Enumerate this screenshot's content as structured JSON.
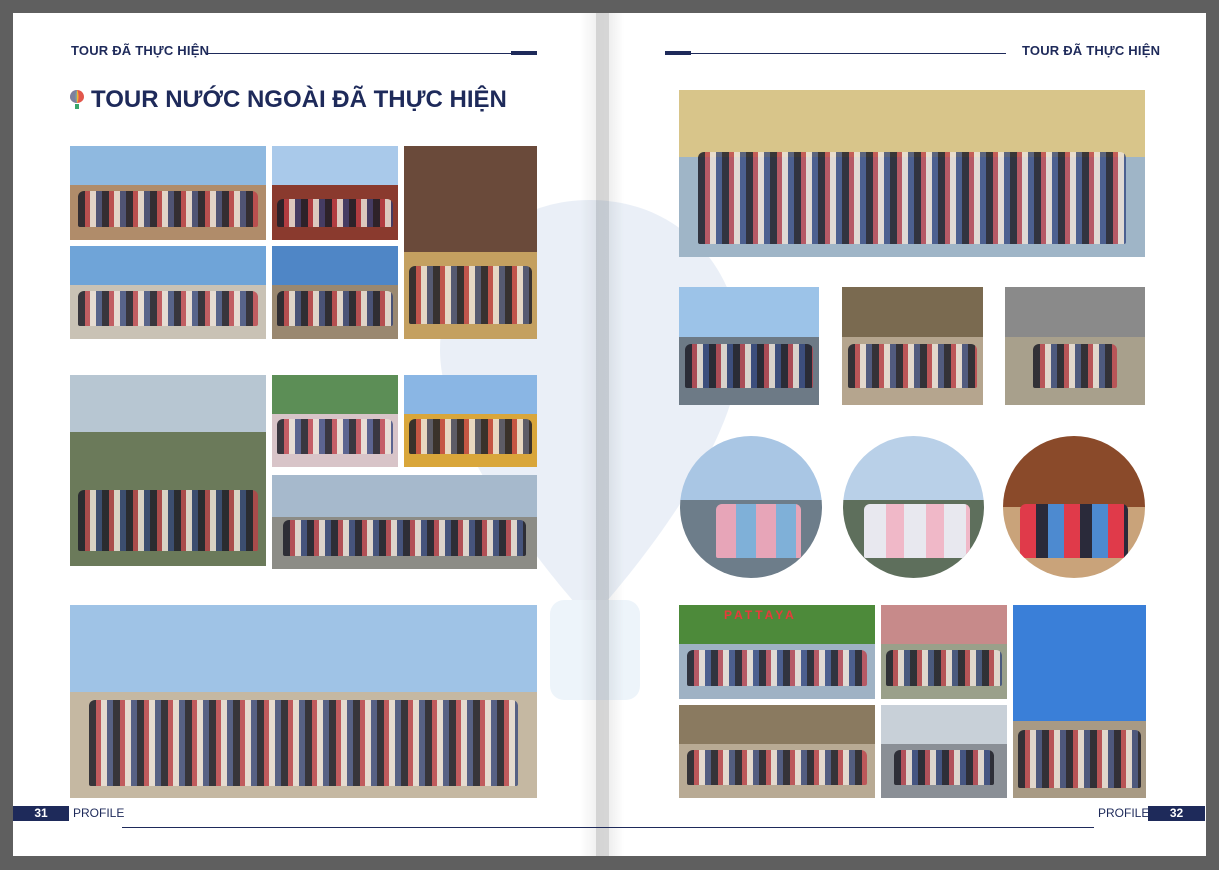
{
  "left_page": {
    "header": "TOUR ĐÃ THỰC HIỆN",
    "title": "TOUR NƯỚC NGOÀI ĐÃ THỰC HIỆN",
    "footer_number": "31",
    "footer_label": "PROFILE"
  },
  "right_page": {
    "header": "TOUR ĐÃ THỰC HIỆN",
    "footer_number": "32",
    "footer_label": "PROFILE"
  },
  "photo_signs": {
    "pattaya": "PATTAYA"
  },
  "colors": {
    "brand_navy": "#1e2a5a",
    "page_bg": "#ffffff",
    "outer_bg": "#5f5f5f"
  }
}
